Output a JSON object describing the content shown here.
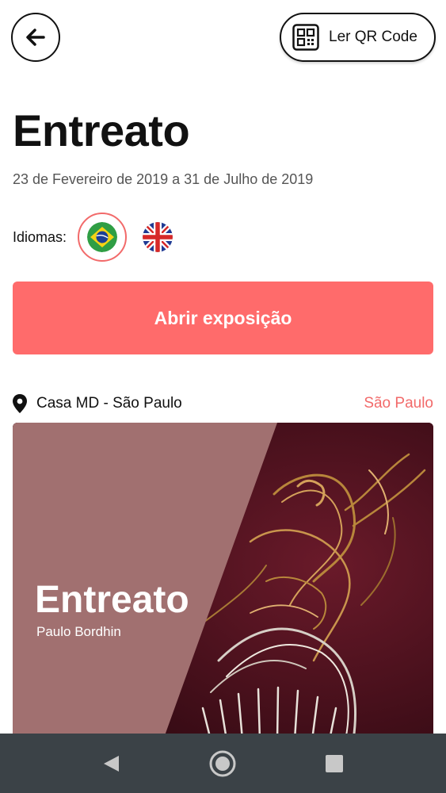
{
  "header": {
    "back_icon": "arrow-left-icon",
    "qr_button_label": "Ler QR Code",
    "qr_icon": "qr-code-icon"
  },
  "exhibition": {
    "title": "Entreato",
    "dates": "23 de Fevereiro de 2019 a 31 de Julho de 2019",
    "languages_label": "Idiomas:",
    "languages": [
      {
        "code": "pt-BR",
        "icon": "brazil-flag-icon",
        "selected": true
      },
      {
        "code": "en",
        "icon": "uk-flag-icon",
        "selected": false
      }
    ],
    "open_button_label": "Abrir exposição",
    "location": "Casa MD - São Paulo",
    "city": "São Paulo"
  },
  "cover": {
    "title": "Entreato",
    "artist": "Paulo Bordhin"
  },
  "colors": {
    "accent": "#ff6b6b",
    "accent_text": "#f26a6a",
    "cover_panel": "#a17070",
    "cover_bg": "#4a0f1c",
    "navbar": "#3b4247"
  },
  "system_nav": {
    "back_icon": "triangle-back-icon",
    "home_icon": "circle-home-icon",
    "recents_icon": "square-recents-icon"
  }
}
